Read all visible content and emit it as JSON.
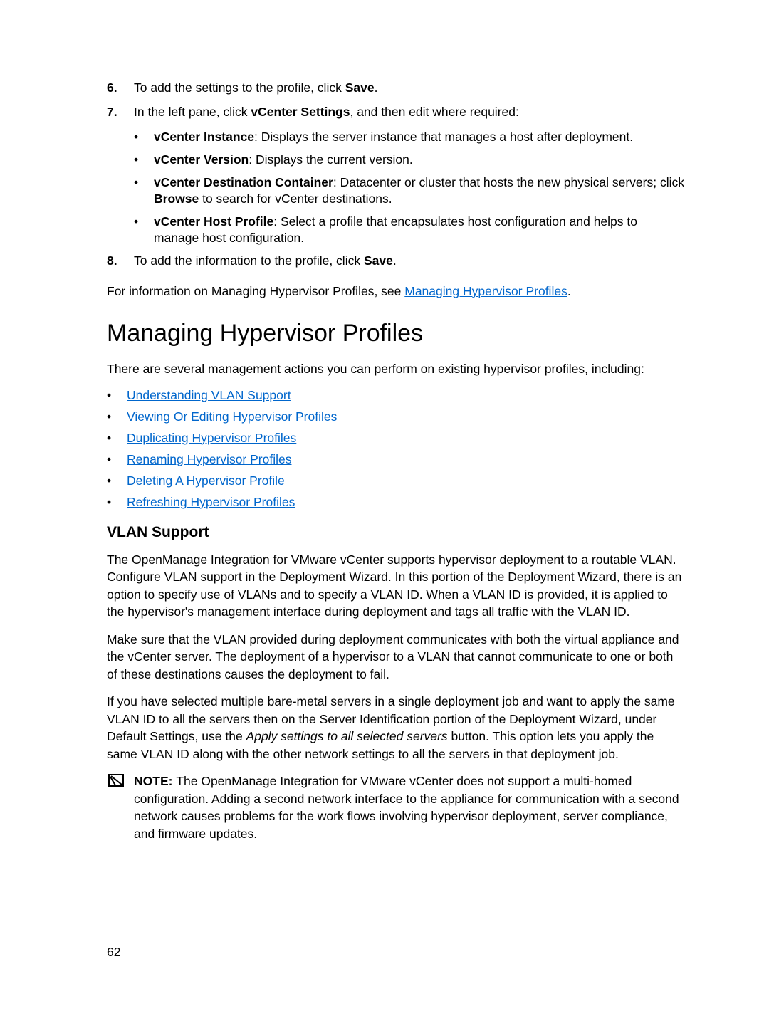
{
  "steps": {
    "six": {
      "num": "6.",
      "pre": "To add the settings to the profile, click ",
      "bold": "Save",
      "post": "."
    },
    "seven": {
      "num": "7.",
      "pre": "In the left pane, click ",
      "bold": "vCenter Settings",
      "post": ", and then edit where required:",
      "subs": [
        {
          "label": "vCenter Instance",
          "text": ": Displays the server instance that manages a host after deployment."
        },
        {
          "label": "vCenter Version",
          "text": ": Displays the current version."
        },
        {
          "label": "vCenter Destination Container",
          "text": ": Datacenter or cluster that hosts the new physical servers; click ",
          "bold2": "Browse",
          "text2": " to search for vCenter destinations."
        },
        {
          "label": "vCenter Host Profile",
          "text": ": Select a profile that encapsulates host configuration and helps to manage host configuration."
        }
      ]
    },
    "eight": {
      "num": "8.",
      "pre": "To add the information to the profile, click ",
      "bold": "Save",
      "post": "."
    }
  },
  "see_line": {
    "pre": "For information on Managing Hypervisor Profiles, see ",
    "link": "Managing Hypervisor Profiles",
    "post": "."
  },
  "h2": "Managing Hypervisor Profiles",
  "intro": "There are several management actions you can perform on existing hypervisor profiles, including:",
  "links": [
    "Understanding VLAN Support",
    "Viewing Or Editing Hypervisor Profiles",
    "Duplicating Hypervisor Profiles",
    "Renaming Hypervisor Profiles",
    "Deleting A Hypervisor Profile",
    "Refreshing Hypervisor Profiles"
  ],
  "h3": "VLAN Support",
  "vlan_p1": "The OpenManage Integration for VMware vCenter supports hypervisor deployment to a routable VLAN. Configure VLAN support in the Deployment Wizard. In this portion of the Deployment Wizard, there is an option to specify use of VLANs and to specify a VLAN ID. When a VLAN ID is provided, it is applied to the hypervisor's management interface during deployment and tags all traffic with the VLAN ID.",
  "vlan_p2": "Make sure that the VLAN provided during deployment communicates with both the virtual appliance and the vCenter server. The deployment of a hypervisor to a VLAN that cannot communicate to one or both of these destinations causes the deployment to fail.",
  "vlan_p3_a": "If you have selected multiple bare-metal servers in a single deployment job and want to apply the same VLAN ID to all the servers then on the Server Identification portion of the Deployment Wizard, under Default Settings, use the ",
  "vlan_p3_i": "Apply settings to all selected servers",
  "vlan_p3_b": " button. This option lets you apply the same VLAN ID along with the other network settings to all the servers in that deployment job.",
  "note_label": "NOTE: ",
  "note_text": "The OpenManage Integration for VMware vCenter does not support a multi-homed configuration. Adding a second network interface to the appliance for communication with a second network causes problems for the work flows involving hypervisor deployment, server compliance, and firmware updates.",
  "page_num": "62"
}
